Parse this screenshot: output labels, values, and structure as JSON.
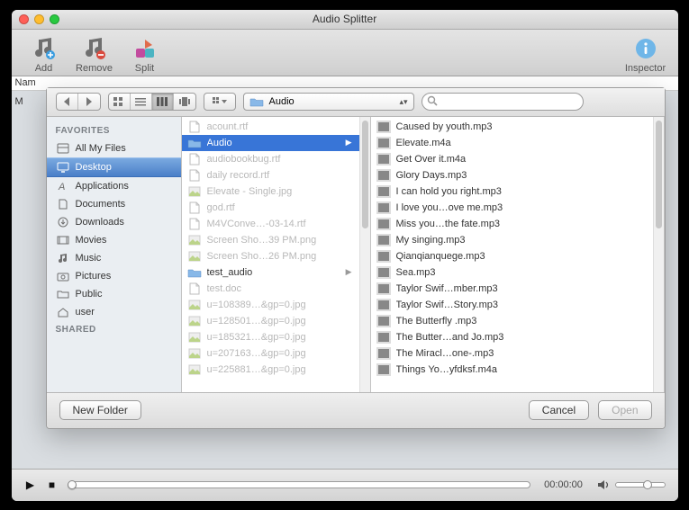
{
  "window": {
    "title": "Audio Splitter"
  },
  "toolbar": {
    "add": "Add",
    "remove": "Remove",
    "split": "Split",
    "inspector": "Inspector"
  },
  "namestrip": {
    "name_header": "Nam",
    "row_prefix": "M"
  },
  "sheet": {
    "path_label": "Audio",
    "search_placeholder": "",
    "sidebar": {
      "favorites_header": "FAVORITES",
      "shared_header": "SHARED",
      "items": [
        {
          "label": "All My Files",
          "icon": "all-my-files-icon"
        },
        {
          "label": "Desktop",
          "icon": "desktop-icon",
          "selected": true
        },
        {
          "label": "Applications",
          "icon": "applications-icon"
        },
        {
          "label": "Documents",
          "icon": "documents-icon"
        },
        {
          "label": "Downloads",
          "icon": "downloads-icon"
        },
        {
          "label": "Movies",
          "icon": "movies-icon"
        },
        {
          "label": "Music",
          "icon": "music-icon"
        },
        {
          "label": "Pictures",
          "icon": "pictures-icon"
        },
        {
          "label": "Public",
          "icon": "folder-icon"
        },
        {
          "label": "user",
          "icon": "home-icon"
        }
      ]
    },
    "col1": [
      {
        "label": "acount.rtf",
        "kind": "doc",
        "dim": true
      },
      {
        "label": "Audio",
        "kind": "folder",
        "selected": true,
        "hasChildren": true
      },
      {
        "label": "audiobookbug.rtf",
        "kind": "doc",
        "dim": true
      },
      {
        "label": "daily record.rtf",
        "kind": "doc",
        "dim": true
      },
      {
        "label": "Elevate - Single.jpg",
        "kind": "img",
        "dim": true
      },
      {
        "label": "god.rtf",
        "kind": "doc",
        "dim": true
      },
      {
        "label": "M4VConve…-03-14.rtf",
        "kind": "doc",
        "dim": true
      },
      {
        "label": "Screen Sho…39 PM.png",
        "kind": "img",
        "dim": true
      },
      {
        "label": "Screen Sho…26 PM.png",
        "kind": "img",
        "dim": true
      },
      {
        "label": "test_audio",
        "kind": "folder",
        "hasChildren": true
      },
      {
        "label": "test.doc",
        "kind": "doc",
        "dim": true
      },
      {
        "label": "u=108389…&gp=0.jpg",
        "kind": "img",
        "dim": true
      },
      {
        "label": "u=128501…&gp=0.jpg",
        "kind": "img",
        "dim": true
      },
      {
        "label": "u=185321…&gp=0.jpg",
        "kind": "img",
        "dim": true
      },
      {
        "label": "u=207163…&gp=0.jpg",
        "kind": "img",
        "dim": true
      },
      {
        "label": "u=225881…&gp=0.jpg",
        "kind": "img",
        "dim": true
      }
    ],
    "col2": [
      {
        "label": "Caused by youth.mp3"
      },
      {
        "label": "Elevate.m4a"
      },
      {
        "label": "Get Over it.m4a"
      },
      {
        "label": "Glory Days.mp3"
      },
      {
        "label": "I can hold you right.mp3"
      },
      {
        "label": "I love you…ove me.mp3"
      },
      {
        "label": "Miss you…the fate.mp3"
      },
      {
        "label": "My singing.mp3"
      },
      {
        "label": "Qianqianquege.mp3"
      },
      {
        "label": "Sea.mp3"
      },
      {
        "label": "Taylor Swif…mber.mp3"
      },
      {
        "label": "Taylor Swif…Story.mp3"
      },
      {
        "label": "The Butterfly .mp3"
      },
      {
        "label": "The Butter…and Jo.mp3"
      },
      {
        "label": "The Miracl…one-.mp3"
      },
      {
        "label": "Things Yo…yfdksf.m4a"
      }
    ],
    "footer": {
      "new_folder": "New Folder",
      "cancel": "Cancel",
      "open": "Open"
    }
  },
  "player": {
    "time": "00:00:00"
  }
}
